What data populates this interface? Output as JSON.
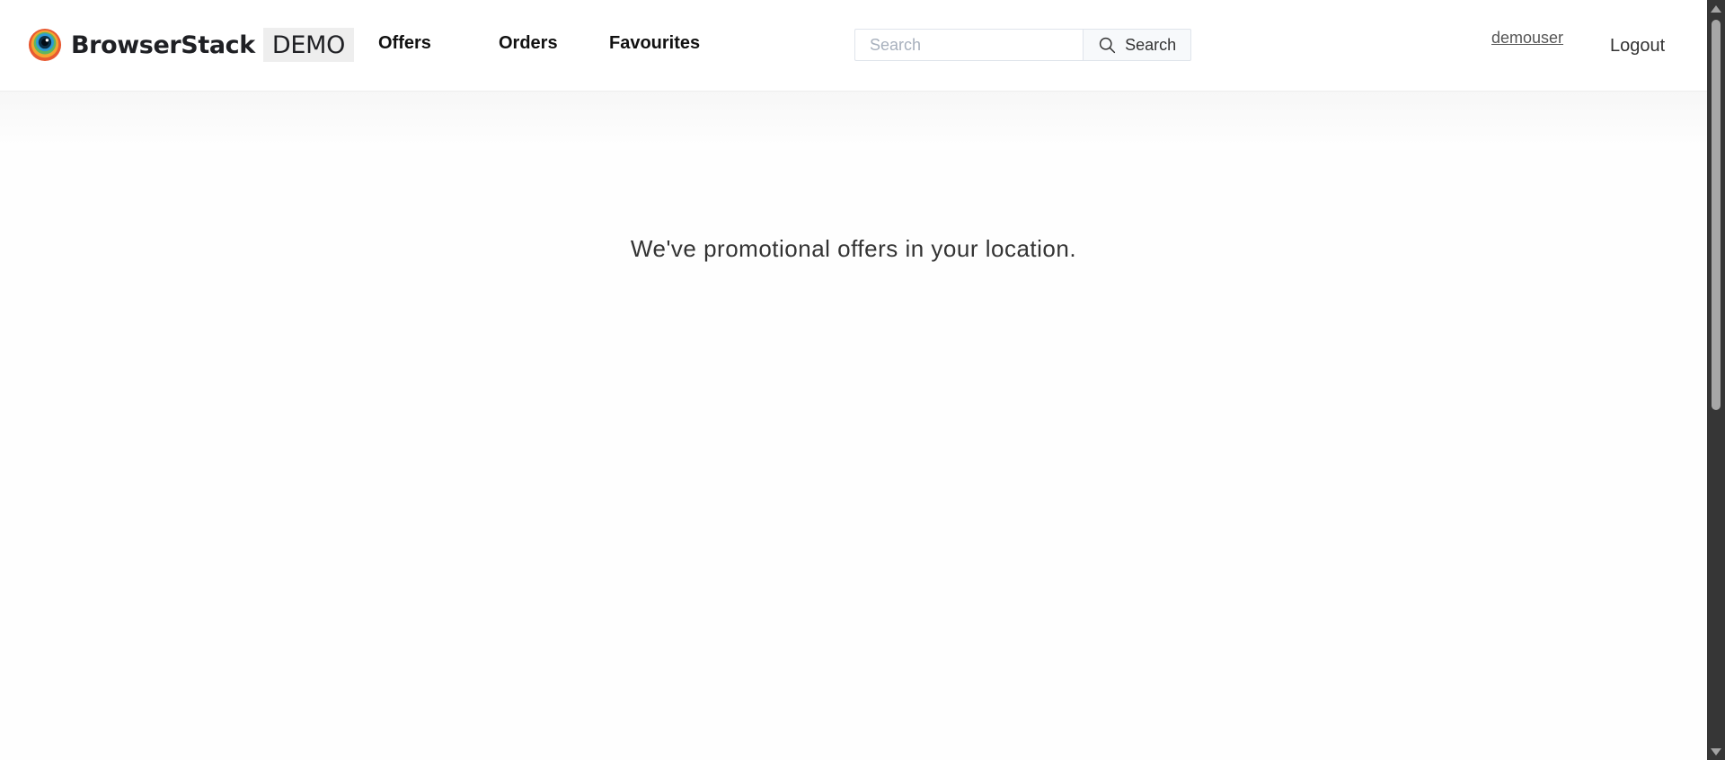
{
  "header": {
    "brand": {
      "name": "BrowserStack",
      "badge": "DEMO",
      "logo_icon": "browserstack-eye-logo-icon"
    },
    "nav": [
      {
        "label": "Offers"
      },
      {
        "label": "Orders"
      },
      {
        "label": "Favourites"
      }
    ],
    "search": {
      "placeholder": "Search",
      "value": "",
      "button_label": "Search",
      "button_icon": "search-icon"
    },
    "user": {
      "username": "demouser",
      "logout_label": "Logout"
    }
  },
  "main": {
    "message": "We've promotional offers in your location."
  },
  "colors": {
    "header_bg": "#ffffff",
    "page_bg": "#fefefe",
    "nav_text": "#111111",
    "body_text": "#333333",
    "brand_badge_bg": "#eeeeee",
    "search_border": "#dfe4eb",
    "search_button_bg": "#f7f9fb",
    "scrollbar_track": "#363636",
    "scrollbar_thumb": "#a6a6a6"
  }
}
